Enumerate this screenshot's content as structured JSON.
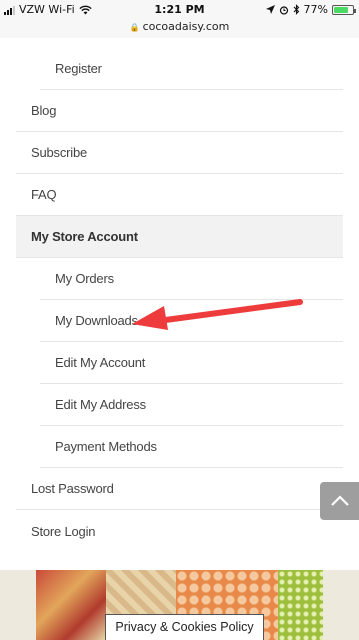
{
  "status_bar": {
    "carrier": "VZW Wi-Fi",
    "time": "1:21 PM",
    "battery": "77%",
    "battery_level": 0.77
  },
  "url_bar": {
    "domain": "cocoadaisy.com"
  },
  "menu": {
    "register": "Register",
    "blog": "Blog",
    "subscribe": "Subscribe",
    "faq": "FAQ",
    "my_store_account": "My Store Account",
    "my_orders": "My Orders",
    "my_downloads": "My Downloads",
    "edit_my_account": "Edit My Account",
    "edit_my_address": "Edit My Address",
    "payment_methods": "Payment Methods",
    "lost_password": "Lost Password",
    "store_login": "Store Login"
  },
  "cookie_button": "Privacy & Cookies Policy",
  "colors": {
    "arrow": "#ee3b3b",
    "scroll_top_bg": "#9e9e9e",
    "battery_fill": "#4cd964"
  }
}
